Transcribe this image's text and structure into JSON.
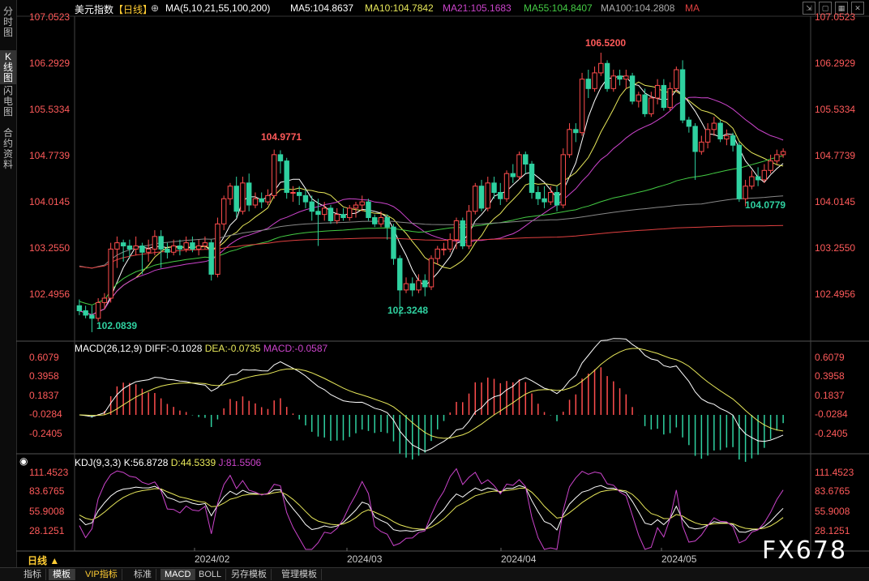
{
  "sidebar": [
    {
      "label": "分\n时\n图",
      "active": false
    },
    {
      "label": "K\n线\n图",
      "active": true
    },
    {
      "label": "闪\n电\n图",
      "active": false
    },
    {
      "label": "合\n约\n资\n料",
      "active": false
    }
  ],
  "header": {
    "symbol": "美元指数",
    "period": "【日线】",
    "ma_params": "MA(5,10,21,55,100,200)",
    "ma5": "MA5:104.8637",
    "ma10": "MA10:104.7842",
    "ma21": "MA21:105.1683",
    "ma55": "MA55:104.8407",
    "ma100": "MA100:104.2808",
    "ma": "MA"
  },
  "price_axis": [
    "107.0523",
    "106.2929",
    "105.5334",
    "104.7739",
    "104.0145",
    "103.2550",
    "102.4956"
  ],
  "annotations": {
    "high1": "104.9771",
    "low1": "102.0839",
    "low2": "102.3248",
    "high2": "106.5200",
    "low3": "104.0779"
  },
  "macd_header": {
    "title": "MACD(26,12,9)",
    "diff": "DIFF:-0.1028",
    "dea": "DEA:-0.0735",
    "macd": "MACD:-0.0587"
  },
  "macd_axis": [
    "0.6079",
    "0.3958",
    "0.1837",
    "-0.0284",
    "-0.2405"
  ],
  "kdj_header": {
    "title": "KDJ(9,3,3)",
    "k": "K:56.8728",
    "d": "D:44.5339",
    "j": "J:81.5506"
  },
  "kdj_axis": [
    "111.4523",
    "83.6765",
    "55.9008",
    "28.1251"
  ],
  "dates": [
    "2024/02",
    "2024/03",
    "2024/04",
    "2024/05"
  ],
  "period_button": "日线 ▲",
  "bottom_tabs": [
    "指标",
    "模板",
    "VIP指标",
    "标准",
    "MACD",
    "BOLL",
    "另存模板",
    "管理模板"
  ],
  "active_tab": "模板",
  "watermark": "FX678",
  "colors": {
    "up": "#ff4d4d",
    "down": "#2fd1a0",
    "ma5": "#ffffff",
    "ma10": "#e8e85a",
    "ma21": "#cc44cc",
    "ma55": "#44cc44",
    "ma100": "#888888",
    "ma200": "#e04040"
  },
  "chart_data": {
    "type": "candlestick",
    "candles": [
      [
        102.5,
        102.42,
        102.6,
        102.35
      ],
      [
        102.42,
        102.35,
        102.5,
        102.3
      ],
      [
        102.35,
        102.3,
        102.5,
        102.08
      ],
      [
        102.3,
        102.55,
        102.62,
        102.25
      ],
      [
        102.55,
        102.62,
        102.7,
        102.45
      ],
      [
        102.62,
        103.4,
        103.5,
        102.55
      ],
      [
        103.4,
        103.5,
        103.6,
        103.1
      ],
      [
        103.5,
        103.45,
        103.55,
        103.2
      ],
      [
        103.45,
        103.4,
        103.55,
        103.25
      ],
      [
        103.4,
        103.45,
        103.6,
        103.3
      ],
      [
        103.45,
        103.35,
        103.5,
        103.0
      ],
      [
        103.35,
        103.4,
        103.55,
        103.2
      ],
      [
        103.4,
        103.6,
        103.7,
        103.3
      ],
      [
        103.6,
        103.4,
        103.7,
        103.1
      ],
      [
        103.4,
        103.35,
        103.5,
        103.25
      ],
      [
        103.35,
        103.45,
        103.55,
        103.3
      ],
      [
        103.45,
        103.4,
        103.55,
        103.3
      ],
      [
        103.4,
        103.5,
        103.6,
        103.35
      ],
      [
        103.5,
        103.4,
        103.6,
        103.35
      ],
      [
        103.4,
        103.45,
        103.55,
        103.3
      ],
      [
        103.45,
        103.5,
        103.6,
        103.4
      ],
      [
        103.5,
        103.0,
        103.55,
        102.9
      ],
      [
        103.0,
        103.8,
        103.9,
        102.95
      ],
      [
        103.8,
        104.2,
        104.25,
        103.7
      ],
      [
        104.2,
        104.4,
        104.45,
        104.1
      ],
      [
        104.4,
        104.0,
        104.55,
        103.9
      ],
      [
        104.0,
        104.45,
        104.55,
        103.95
      ],
      [
        104.45,
        104.1,
        104.6,
        104.0
      ],
      [
        104.1,
        104.2,
        104.3,
        104.05
      ],
      [
        104.2,
        104.15,
        104.3,
        104.05
      ],
      [
        104.15,
        104.25,
        104.35,
        104.1
      ],
      [
        104.25,
        104.9,
        104.98,
        104.2
      ],
      [
        104.9,
        104.8,
        104.97,
        104.6
      ],
      [
        104.8,
        104.3,
        104.85,
        104.2
      ],
      [
        104.3,
        104.3,
        104.4,
        104.15
      ],
      [
        104.3,
        104.25,
        104.4,
        104.1
      ],
      [
        104.25,
        104.15,
        104.35,
        104.05
      ],
      [
        104.15,
        104.0,
        104.25,
        103.85
      ],
      [
        104.0,
        103.95,
        104.2,
        103.45
      ],
      [
        103.95,
        104.05,
        104.15,
        103.85
      ],
      [
        104.05,
        103.85,
        104.1,
        103.8
      ],
      [
        103.85,
        103.95,
        104.05,
        103.8
      ],
      [
        103.95,
        103.9,
        104.05,
        103.85
      ],
      [
        103.9,
        104.05,
        104.1,
        103.85
      ],
      [
        104.05,
        104.1,
        104.15,
        103.9
      ],
      [
        104.1,
        104.15,
        104.25,
        104.0
      ],
      [
        104.15,
        103.9,
        104.2,
        103.85
      ],
      [
        103.9,
        103.8,
        103.95,
        103.75
      ],
      [
        103.8,
        103.9,
        104.0,
        103.75
      ],
      [
        103.9,
        103.75,
        103.95,
        103.55
      ],
      [
        103.75,
        103.25,
        103.8,
        103.15
      ],
      [
        103.25,
        102.75,
        103.3,
        102.33
      ],
      [
        102.75,
        102.85,
        102.95,
        102.7
      ],
      [
        102.85,
        102.75,
        102.95,
        102.65
      ],
      [
        102.75,
        102.9,
        103.0,
        102.7
      ],
      [
        102.9,
        102.8,
        103.0,
        102.65
      ],
      [
        102.8,
        103.25,
        103.3,
        102.75
      ],
      [
        103.25,
        103.4,
        103.45,
        103.15
      ],
      [
        103.4,
        103.4,
        103.5,
        103.3
      ],
      [
        103.4,
        103.55,
        103.65,
        103.35
      ],
      [
        103.55,
        103.85,
        103.9,
        103.4
      ],
      [
        103.85,
        103.45,
        103.9,
        103.4
      ],
      [
        103.45,
        104.0,
        104.1,
        103.4
      ],
      [
        104.0,
        104.4,
        104.45,
        103.95
      ],
      [
        104.4,
        104.05,
        104.5,
        104.0
      ],
      [
        104.05,
        104.45,
        104.55,
        104.0
      ],
      [
        104.45,
        104.3,
        104.55,
        104.2
      ],
      [
        104.3,
        104.2,
        104.45,
        104.1
      ],
      [
        104.2,
        104.6,
        104.65,
        104.15
      ],
      [
        104.6,
        104.55,
        104.75,
        104.45
      ],
      [
        104.55,
        104.9,
        104.95,
        104.5
      ],
      [
        104.9,
        104.75,
        104.95,
        104.6
      ],
      [
        104.75,
        104.3,
        104.8,
        104.2
      ],
      [
        104.3,
        104.2,
        104.4,
        104.1
      ],
      [
        104.2,
        104.15,
        104.4,
        104.05
      ],
      [
        104.15,
        104.3,
        104.4,
        104.1
      ],
      [
        104.3,
        104.1,
        104.4,
        104.0
      ],
      [
        104.1,
        104.9,
        105.0,
        104.05
      ],
      [
        104.9,
        105.3,
        105.4,
        104.85
      ],
      [
        105.3,
        105.25,
        105.4,
        105.1
      ],
      [
        105.25,
        106.1,
        106.2,
        105.2
      ],
      [
        106.1,
        105.95,
        106.25,
        105.8
      ],
      [
        105.95,
        106.2,
        106.3,
        105.9
      ],
      [
        106.2,
        106.35,
        106.52,
        106.15
      ],
      [
        106.35,
        105.95,
        106.4,
        105.9
      ],
      [
        105.95,
        106.15,
        106.25,
        105.9
      ],
      [
        106.15,
        106.1,
        106.25,
        106.0
      ],
      [
        106.1,
        106.15,
        106.25,
        105.95
      ],
      [
        106.15,
        105.75,
        106.2,
        105.7
      ],
      [
        105.75,
        105.85,
        105.9,
        105.65
      ],
      [
        105.85,
        105.55,
        105.95,
        105.5
      ],
      [
        105.55,
        105.8,
        105.9,
        105.5
      ],
      [
        105.8,
        106.0,
        106.1,
        105.7
      ],
      [
        106.0,
        105.65,
        106.1,
        105.6
      ],
      [
        105.65,
        105.95,
        106.05,
        105.6
      ],
      [
        105.95,
        106.25,
        106.3,
        105.9
      ],
      [
        106.25,
        105.45,
        106.4,
        105.4
      ],
      [
        105.45,
        105.35,
        105.5,
        105.25
      ],
      [
        105.35,
        104.95,
        105.4,
        104.5
      ],
      [
        104.95,
        105.1,
        105.2,
        104.9
      ],
      [
        105.1,
        105.3,
        105.4,
        105.0
      ],
      [
        105.3,
        105.4,
        105.5,
        105.2
      ],
      [
        105.4,
        105.15,
        105.45,
        105.1
      ],
      [
        105.15,
        105.2,
        105.3,
        105.05
      ],
      [
        105.2,
        105.05,
        105.25,
        104.95
      ],
      [
        105.05,
        104.2,
        105.1,
        104.15
      ],
      [
        104.2,
        104.4,
        104.5,
        104.08
      ],
      [
        104.4,
        104.55,
        104.65,
        104.35
      ],
      [
        104.55,
        104.5,
        104.7,
        104.4
      ],
      [
        104.5,
        104.65,
        104.75,
        104.45
      ],
      [
        104.65,
        104.8,
        104.9,
        104.6
      ],
      [
        104.8,
        104.9,
        104.98,
        104.75
      ],
      [
        104.9,
        104.95,
        105.0,
        104.85
      ]
    ],
    "macd_hist_note": "MACD histogram bars (red positive, green negative), DIFF white line, DEA yellow line",
    "kdj_lines": "K white, D yellow, J magenta"
  }
}
